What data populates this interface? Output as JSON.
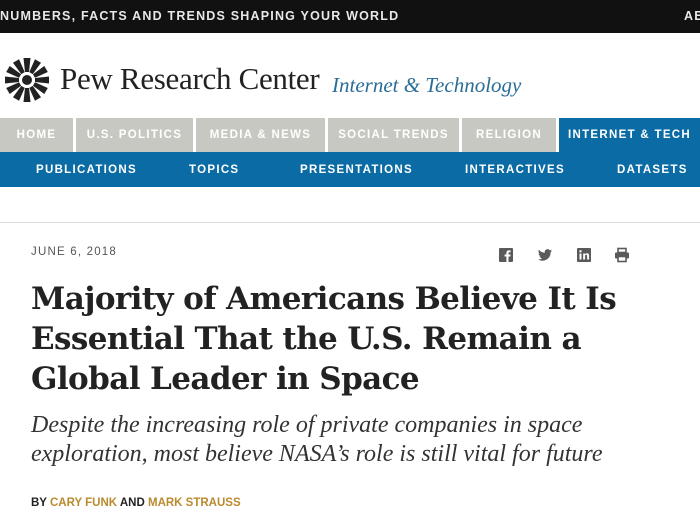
{
  "top_bar": {
    "tagline": "NUMBERS, FACTS AND TRENDS SHAPING YOUR WORLD",
    "right_cutoff": "AE"
  },
  "masthead": {
    "brand": "Pew Research Center",
    "section": "Internet & Technology"
  },
  "primary_nav": [
    {
      "label": "HOME",
      "active": false
    },
    {
      "label": "U.S. POLITICS",
      "active": false
    },
    {
      "label": "MEDIA & NEWS",
      "active": false
    },
    {
      "label": "SOCIAL TRENDS",
      "active": false
    },
    {
      "label": "RELIGION",
      "active": false
    },
    {
      "label": "INTERNET & TECH",
      "active": true
    }
  ],
  "secondary_nav": [
    "PUBLICATIONS",
    "TOPICS",
    "PRESENTATIONS",
    "INTERACTIVES",
    "DATASETS"
  ],
  "article": {
    "date": "JUNE 6, 2018",
    "headline": "Majority of Americans Believe It Is Essential That the U.S. Remain a Global Leader in Space",
    "dek": "Despite the increasing role of private companies in space exploration, most believe NASA’s role is still vital for future",
    "byline": {
      "prefix": "BY",
      "author1": "CARY FUNK",
      "joiner": "AND",
      "author2": "MARK STRAUSS"
    }
  },
  "share_icons": [
    "facebook-icon",
    "twitter-icon",
    "linkedin-icon",
    "print-icon"
  ],
  "colors": {
    "accent_blue": "#0b6ba4",
    "nav_gray": "#c8c8c2",
    "section_blue": "#2b6d96",
    "author_gold": "#b98a2e",
    "top_bar": "#111111"
  }
}
